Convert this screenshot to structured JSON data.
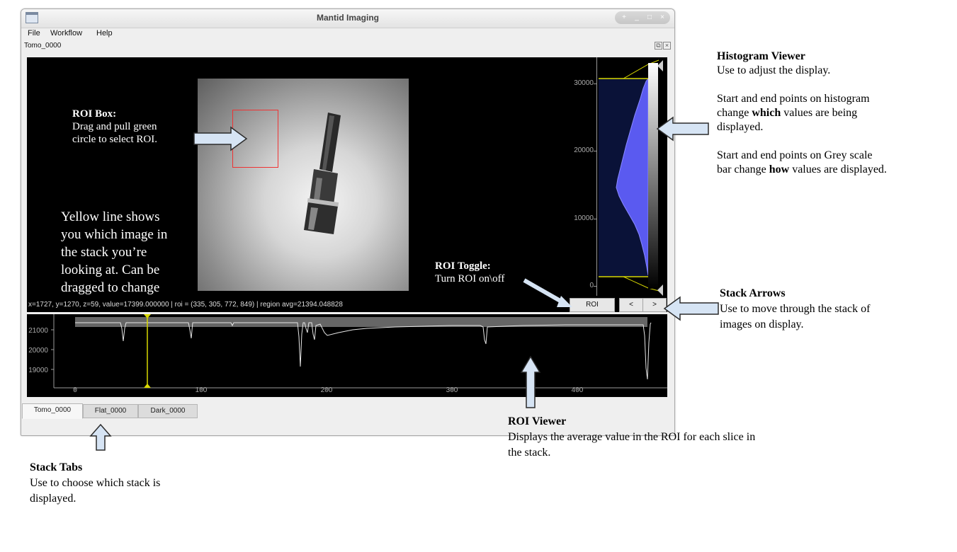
{
  "window": {
    "title": "Mantid Imaging",
    "menu": [
      "File",
      "Workflow",
      "Help"
    ],
    "dock_title": "Tomo_0000"
  },
  "viewer": {
    "status": "x=1727, y=1270, z=59, value=17399.000000 | roi = (335, 305, 772, 849) | region avg=21394.048828",
    "roi_button": "ROI",
    "prev_button": "<",
    "next_button": ">"
  },
  "histogram": {
    "ticks": [
      "30000",
      "20000",
      "10000",
      "0"
    ]
  },
  "roi_plot": {
    "y_ticks": [
      "21000",
      "20000",
      "19000"
    ],
    "x_ticks": [
      "0",
      "100",
      "200",
      "300",
      "400"
    ]
  },
  "tabs": [
    "Tomo_0000",
    "Flat_0000",
    "Dark_0000"
  ],
  "annotations": {
    "roi_box_title": "ROI Box:",
    "roi_box_text1": "Drag and pull green",
    "roi_box_text2": "circle to select ROI.",
    "yellow_line_1": "Yellow line shows",
    "yellow_line_2": "you which image in",
    "yellow_line_3": "the stack you’re",
    "yellow_line_4": "looking at. Can be",
    "yellow_line_5": "dragged to change",
    "roi_toggle_title": "ROI Toggle:",
    "roi_toggle_text": "Turn ROI on\\off",
    "hist_title": "Histogram Viewer",
    "hist_text1": "Use to adjust the  display.",
    "hist_p2_1": "Start and end points on histogram",
    "hist_p2_2a": "change ",
    "hist_p2_2b": "which",
    "hist_p2_2c": " values are being",
    "hist_p2_3": "displayed.",
    "hist_p3_1": "Start and end points on Grey scale",
    "hist_p3_2a": "bar change ",
    "hist_p3_2b": "how",
    "hist_p3_2c": " values are displayed.",
    "arrows_title": "Stack Arrows",
    "arrows_text1": "Use to move through the stack of",
    "arrows_text2": "images on display.",
    "roi_viewer_title": "ROI Viewer",
    "roi_viewer_text1": "Displays the average value in the ROI for each slice in",
    "roi_viewer_text2": "the stack.",
    "tabs_title": "Stack Tabs",
    "tabs_text1": "Use to choose which stack is",
    "tabs_text2": "displayed."
  },
  "colors": {
    "roi": "#e33333",
    "histogram": "#5a5af0",
    "marker": "#d8d800"
  }
}
